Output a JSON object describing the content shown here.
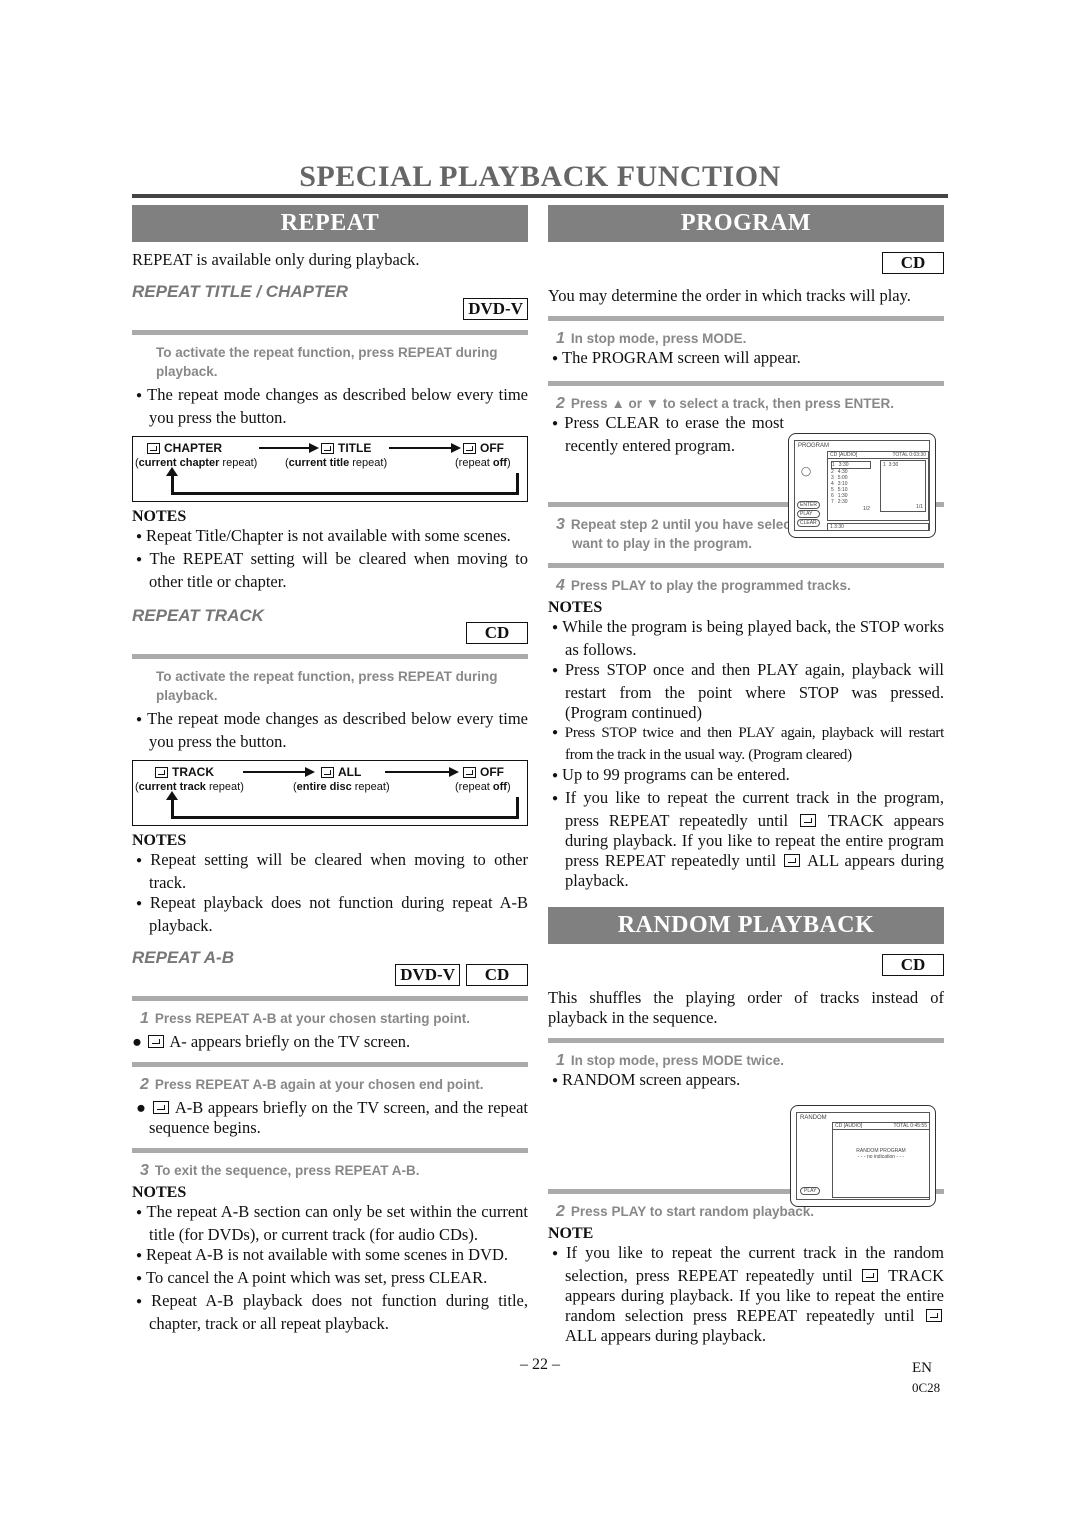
{
  "page_title": "SPECIAL PLAYBACK FUNCTION",
  "repeat": {
    "banner": "REPEAT",
    "intro": "REPEAT is available only during playback.",
    "title_chapter": {
      "heading": "REPEAT TITLE / CHAPTER",
      "badges": [
        "DVD-V"
      ],
      "step": "To activate the repeat function, press REPEAT during playback.",
      "bullet": "The repeat mode changes as described below every time you press the button.",
      "diagram": {
        "items": [
          {
            "label": "CHAPTER",
            "caption_bold": "current chapter",
            "caption": " repeat"
          },
          {
            "label": "TITLE",
            "caption_bold": "current title",
            "caption": " repeat"
          },
          {
            "label": "OFF",
            "caption_pre": "repeat ",
            "caption_bold": "off"
          }
        ]
      },
      "notes_heading": "NOTES",
      "notes": [
        "Repeat Title/Chapter is not available with some scenes.",
        "The REPEAT setting will be cleared when moving to other title or chapter."
      ]
    },
    "track": {
      "heading": "REPEAT TRACK",
      "badges": [
        "CD"
      ],
      "step": "To activate the repeat function, press REPEAT during playback.",
      "bullet": "The repeat mode changes as described below every time you press the button.",
      "diagram": {
        "items": [
          {
            "label": "TRACK",
            "caption_bold": "current track",
            "caption": " repeat"
          },
          {
            "label": "ALL",
            "caption_bold": "entire disc",
            "caption": " repeat"
          },
          {
            "label": "OFF",
            "caption_pre": "repeat ",
            "caption_bold": "off"
          }
        ]
      },
      "notes_heading": "NOTES",
      "notes": [
        "Repeat setting will be cleared when moving to other track.",
        "Repeat playback does not function during repeat A-B playback."
      ]
    },
    "ab": {
      "heading": "REPEAT A-B",
      "badges": [
        "DVD-V",
        "CD"
      ],
      "steps": [
        {
          "num": "1",
          "text": "Press REPEAT A-B at your chosen starting point.",
          "bullet": "A- appears briefly on the TV screen."
        },
        {
          "num": "2",
          "text": "Press REPEAT A-B again at your chosen end point.",
          "bullet": "A-B appears briefly on the TV screen, and the repeat sequence begins."
        },
        {
          "num": "3",
          "text": "To exit the sequence, press REPEAT A-B."
        }
      ],
      "notes_heading": "NOTES",
      "notes": [
        "The repeat A-B section can only be set within the current title (for DVDs), or current track (for audio CDs).",
        "Repeat A-B is not available with some scenes in DVD.",
        "To cancel the A point which was set, press CLEAR.",
        "Repeat A-B playback does not function during title, chapter, track or all repeat playback."
      ]
    }
  },
  "program": {
    "banner": "PROGRAM",
    "badges": [
      "CD"
    ],
    "intro": "You may determine the order in which tracks will play.",
    "steps": [
      {
        "num": "1",
        "text": "In stop mode, press MODE.",
        "bullet": "The PROGRAM screen will appear."
      },
      {
        "num": "2",
        "text": "Press ▲ or ▼ to select a track, then press ENTER.",
        "bullet": "Press CLEAR to erase the most recently entered program."
      },
      {
        "num": "3",
        "text": "Repeat step 2 until you have selected all the tracks you want to play in the program."
      },
      {
        "num": "4",
        "text": "Press PLAY to play the programmed tracks."
      }
    ],
    "screen": {
      "label": "PROGRAM",
      "header_left": "CD [AUDIO]",
      "header_right": "TOTAL 0:03:30",
      "tracks": [
        {
          "n": "1",
          "t": "3:30"
        },
        {
          "n": "2",
          "t": "4:30"
        },
        {
          "n": "3",
          "t": "5:00"
        },
        {
          "n": "4",
          "t": "3:10"
        },
        {
          "n": "5",
          "t": "5:10"
        },
        {
          "n": "6",
          "t": "1:30"
        },
        {
          "n": "7",
          "t": "2:30"
        }
      ],
      "page_left": "1/2",
      "program_list": [
        {
          "n": "1",
          "t": "3:30"
        }
      ],
      "page_right": "1/1",
      "bottom": "1  3:30",
      "buttons": [
        "ENTER",
        "PLAY",
        "CLEAR"
      ]
    },
    "notes_heading": "NOTES",
    "notes": [
      "While the program is being played back, the STOP works as follows.",
      "Press STOP once and then PLAY again, playback will restart from the point where STOP was pressed. (Program continued)",
      "Press STOP twice and then PLAY again, playback will restart from the track in the usual way. (Program cleared)",
      "Up to 99 programs can be entered.",
      "If you like to repeat the current track in the program, press REPEAT repeatedly until [icon] TRACK appears during playback. If you like to repeat the entire program press REPEAT repeatedly until [icon] ALL appears during playback."
    ],
    "note5_parts": [
      "If you like to repeat the current track in the program, press REPEAT repeatedly until ",
      " TRACK appears during playback. If you like to repeat the entire program press REPEAT repeatedly until ",
      " ALL appears during playback."
    ]
  },
  "random": {
    "banner": "RANDOM PLAYBACK",
    "badges": [
      "CD"
    ],
    "intro": "This shuffles the playing order of tracks instead of playback in the sequence.",
    "steps": [
      {
        "num": "1",
        "text": "In stop mode, press MODE twice.",
        "bullet": "RANDOM screen appears."
      },
      {
        "num": "2",
        "text": "Press PLAY to start random playback."
      }
    ],
    "screen": {
      "label": "RANDOM",
      "header_left": "CD [AUDIO]",
      "header_right": "TOTAL 0:45:55",
      "center_line1": "RANDOM PROGRAM",
      "center_line2": "- - - no indication - - -",
      "button": "PLAY"
    },
    "note_heading": "NOTE",
    "note_parts": [
      "If you like to repeat the current track in the random selection, press REPEAT repeatedly until ",
      " TRACK appears during playback. If you like to repeat the entire random selection press REPEAT repeatedly until ",
      " ALL appears during playback."
    ]
  },
  "footer": {
    "page_number": "– 22 –",
    "lang": "EN",
    "code": "0C28"
  }
}
